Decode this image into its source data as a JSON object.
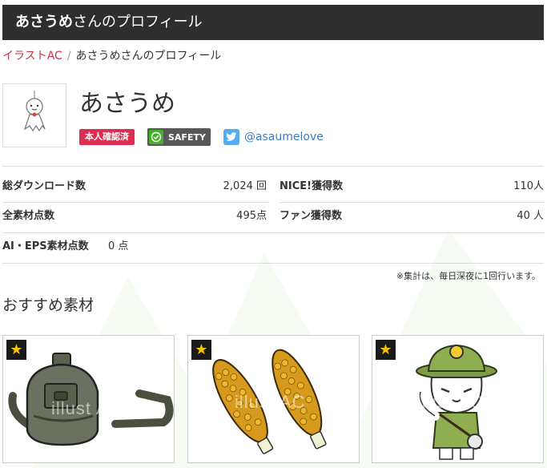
{
  "header": {
    "title_bold": "あさうめ",
    "title_rest": "さんのプロフィール"
  },
  "breadcrumb": {
    "home": "イラストAC",
    "separator": "/",
    "current": "あさうめさんのプロフィール"
  },
  "profile": {
    "name": "あさうめ",
    "badge_verified": "本人確認済",
    "badge_safety": "SAFETY",
    "twitter_handle": "@asaumelove"
  },
  "stats": {
    "downloads_label": "総ダウンロード数",
    "downloads_value": "2,024 回",
    "nice_label": "NICE!獲得数",
    "nice_value": "110人",
    "materials_label": "全素材点数",
    "materials_value": "495点",
    "fans_label": "ファン獲得数",
    "fans_value": "40 人",
    "ai_eps_label": "AI・EPS素材点数",
    "ai_eps_value": "0 点"
  },
  "note": "※集計は、毎日深夜に1回行います。",
  "recommended": {
    "title": "おすすめ素材",
    "items": [
      {
        "icon": "canteen-illustration"
      },
      {
        "icon": "corn-illustration"
      },
      {
        "icon": "explorer-cat-illustration"
      }
    ]
  },
  "watermark": "illust AC",
  "colors": {
    "header_bg": "#2e2e2e",
    "accent_red": "#dc2e50",
    "link_red": "#d0304a",
    "safety_green": "#43b02a",
    "twitter_blue": "#55acee",
    "link_blue": "#3b7bc5"
  }
}
